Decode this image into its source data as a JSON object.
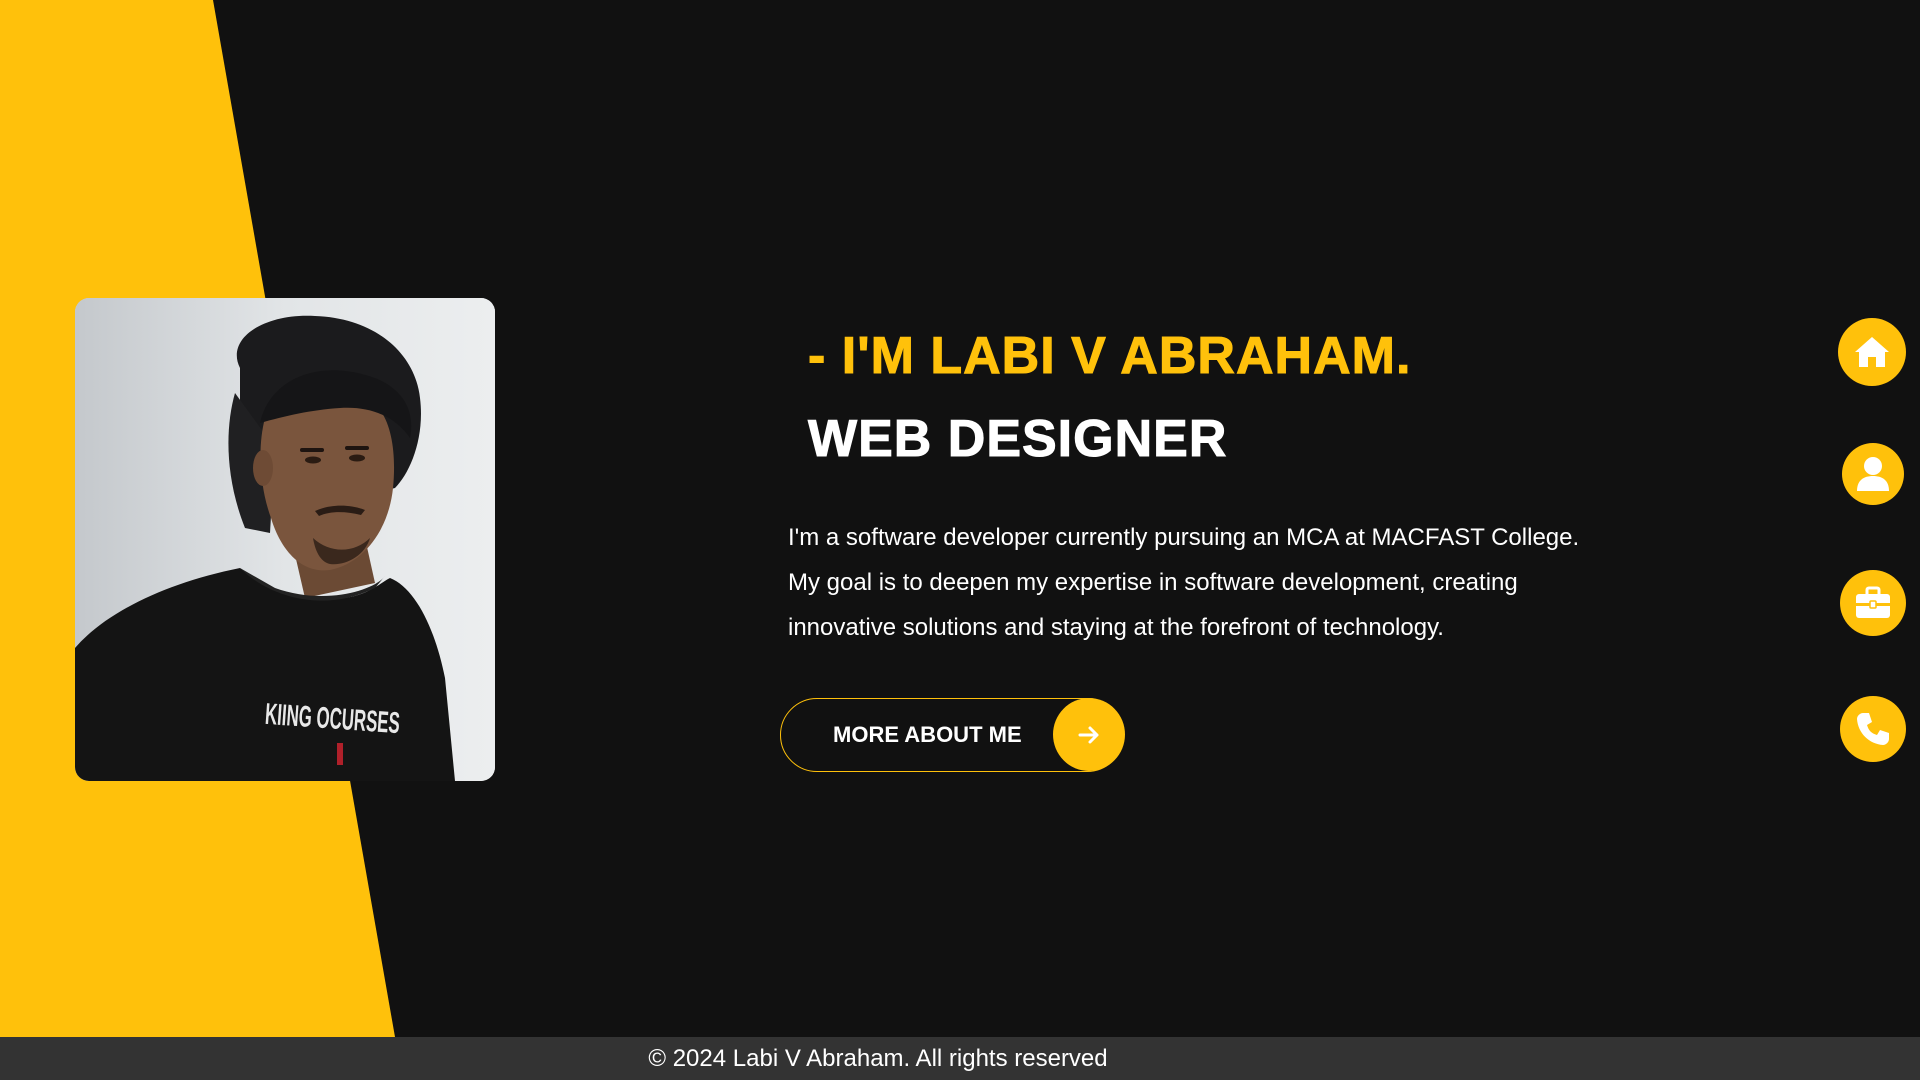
{
  "hero": {
    "intro": "- I'M LABI V ABRAHAM.",
    "role": "WEB DESIGNER",
    "bio": "I'm a software developer currently pursuing an MCA at MACFAST College. My goal is to deepen my expertise in software development, creating innovative solutions and staying at the forefront of technology.",
    "shirt_print": "KIING OCURSES"
  },
  "cta": {
    "label": "MORE ABOUT ME",
    "icon": "arrow-right-icon"
  },
  "side_nav": [
    {
      "icon": "home-icon"
    },
    {
      "icon": "user-icon"
    },
    {
      "icon": "briefcase-icon"
    },
    {
      "icon": "phone-icon"
    }
  ],
  "footer": {
    "text": "© 2024 Labi V Abraham. All rights reserved"
  },
  "colors": {
    "accent": "#ffc10b",
    "background": "#111111",
    "footer_bg": "#333333",
    "text": "#ffffff"
  }
}
